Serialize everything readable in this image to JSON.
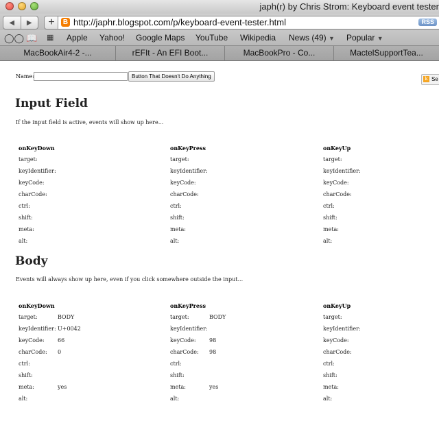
{
  "window": {
    "title": "japh(r) by Chris Strom: Keyboard event tester"
  },
  "toolbar": {
    "back_icon": "back-arrow",
    "forward_icon": "forward-arrow",
    "add_icon": "plus",
    "url": "http://japhr.blogspot.com/p/keyboard-event-tester.html",
    "rss_label": "RSS"
  },
  "bookmarks": {
    "items": [
      "Apple",
      "Yahoo!",
      "Google Maps",
      "YouTube",
      "Wikipedia",
      "News (49)",
      "Popular"
    ]
  },
  "tabs": [
    "MacBookAir4-2 -...",
    "rEFIt - An EFI Boot...",
    "MacBookPro - Co...",
    "MactelSupportTea..."
  ],
  "page": {
    "name_label": "Name:",
    "name_value": "",
    "button_label": "Button That Doesn't Do Anything",
    "side_button_label": "Se",
    "input_section": {
      "heading": "Input Field",
      "description": "If the input field is active, events will show up here...",
      "columns": [
        {
          "header": "onKeyDown",
          "rows": [
            {
              "label": "target:",
              "value": ""
            },
            {
              "label": "keyIdentifier:",
              "value": ""
            },
            {
              "label": "keyCode:",
              "value": ""
            },
            {
              "label": "charCode:",
              "value": ""
            },
            {
              "label": "ctrl:",
              "value": ""
            },
            {
              "label": "shift:",
              "value": ""
            },
            {
              "label": "meta:",
              "value": ""
            },
            {
              "label": "alt:",
              "value": ""
            }
          ]
        },
        {
          "header": "onKeyPress",
          "rows": [
            {
              "label": "target:",
              "value": ""
            },
            {
              "label": "keyIdentifier:",
              "value": ""
            },
            {
              "label": "keyCode:",
              "value": ""
            },
            {
              "label": "charCode:",
              "value": ""
            },
            {
              "label": "ctrl:",
              "value": ""
            },
            {
              "label": "shift:",
              "value": ""
            },
            {
              "label": "meta:",
              "value": ""
            },
            {
              "label": "alt:",
              "value": ""
            }
          ]
        },
        {
          "header": "onKeyUp",
          "rows": [
            {
              "label": "target:",
              "value": ""
            },
            {
              "label": "keyIdentifier:",
              "value": ""
            },
            {
              "label": "keyCode:",
              "value": ""
            },
            {
              "label": "charCode:",
              "value": ""
            },
            {
              "label": "ctrl:",
              "value": ""
            },
            {
              "label": "shift:",
              "value": ""
            },
            {
              "label": "meta:",
              "value": ""
            },
            {
              "label": "alt:",
              "value": ""
            }
          ]
        }
      ]
    },
    "body_section": {
      "heading": "Body",
      "description": "Events will always show up here, even if you click somewhere outside the input...",
      "columns": [
        {
          "header": "onKeyDown",
          "rows": [
            {
              "label": "target:",
              "value": "BODY"
            },
            {
              "label": "keyIdentifier:",
              "value": "U+0042"
            },
            {
              "label": "keyCode:",
              "value": "66"
            },
            {
              "label": "charCode:",
              "value": "0"
            },
            {
              "label": "ctrl:",
              "value": ""
            },
            {
              "label": "shift:",
              "value": ""
            },
            {
              "label": "meta:",
              "value": "yes"
            },
            {
              "label": "alt:",
              "value": ""
            }
          ]
        },
        {
          "header": "onKeyPress",
          "rows": [
            {
              "label": "target:",
              "value": "BODY"
            },
            {
              "label": "keyIdentifier:",
              "value": ""
            },
            {
              "label": "keyCode:",
              "value": "98"
            },
            {
              "label": "charCode:",
              "value": "98"
            },
            {
              "label": "ctrl:",
              "value": ""
            },
            {
              "label": "shift:",
              "value": ""
            },
            {
              "label": "meta:",
              "value": "yes"
            },
            {
              "label": "alt:",
              "value": ""
            }
          ]
        },
        {
          "header": "onKeyUp",
          "rows": [
            {
              "label": "target:",
              "value": ""
            },
            {
              "label": "keyIdentifier:",
              "value": ""
            },
            {
              "label": "keyCode:",
              "value": ""
            },
            {
              "label": "charCode:",
              "value": ""
            },
            {
              "label": "ctrl:",
              "value": ""
            },
            {
              "label": "shift:",
              "value": ""
            },
            {
              "label": "meta:",
              "value": ""
            },
            {
              "label": "alt:",
              "value": ""
            }
          ]
        }
      ]
    }
  }
}
